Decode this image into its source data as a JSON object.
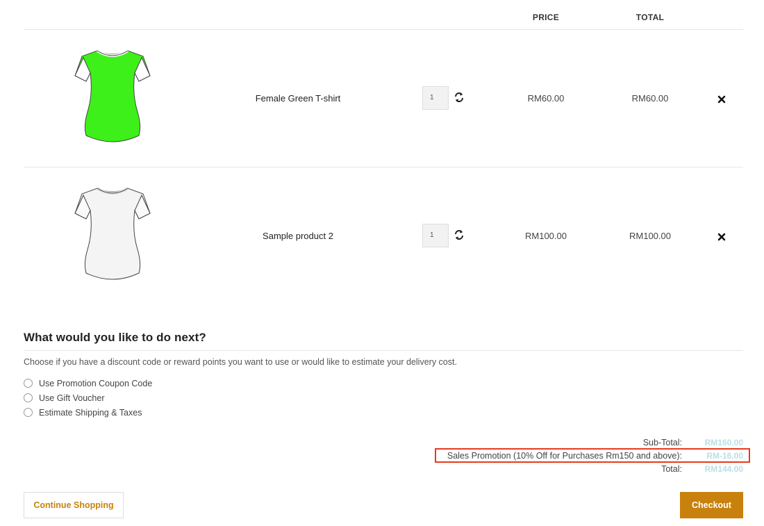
{
  "cart": {
    "columns": {
      "price": "PRICE",
      "total": "TOTAL"
    },
    "items": [
      {
        "name": "Female Green T-shirt",
        "quantity": "1",
        "price": "RM60.00",
        "total": "RM60.00",
        "color": "#3ef019"
      },
      {
        "name": "Sample product 2",
        "quantity": "1",
        "price": "RM100.00",
        "total": "RM100.00",
        "color": "#f4f4f4"
      }
    ]
  },
  "next": {
    "heading": "What would you like to do next?",
    "description": "Choose if you have a discount code or reward points you want to use or would like to estimate your delivery cost.",
    "options": [
      "Use Promotion Coupon Code",
      "Use Gift Voucher",
      "Estimate Shipping & Taxes"
    ]
  },
  "totals": {
    "subtotal_label": "Sub-Total:",
    "subtotal_value": "RM160.00",
    "promo_label": "Sales Promotion (10% Off for Purchases Rm150 and above):",
    "promo_value": "RM-16.00",
    "total_label": "Total:",
    "total_value": "RM144.00"
  },
  "buttons": {
    "continue": "Continue Shopping",
    "checkout": "Checkout"
  },
  "colors": {
    "accent": "#c8810d",
    "highlight_border": "#e53b1b",
    "totals_value": "#b9e0e4"
  },
  "icons": {
    "refresh": "refresh-icon",
    "remove": "close-icon"
  }
}
